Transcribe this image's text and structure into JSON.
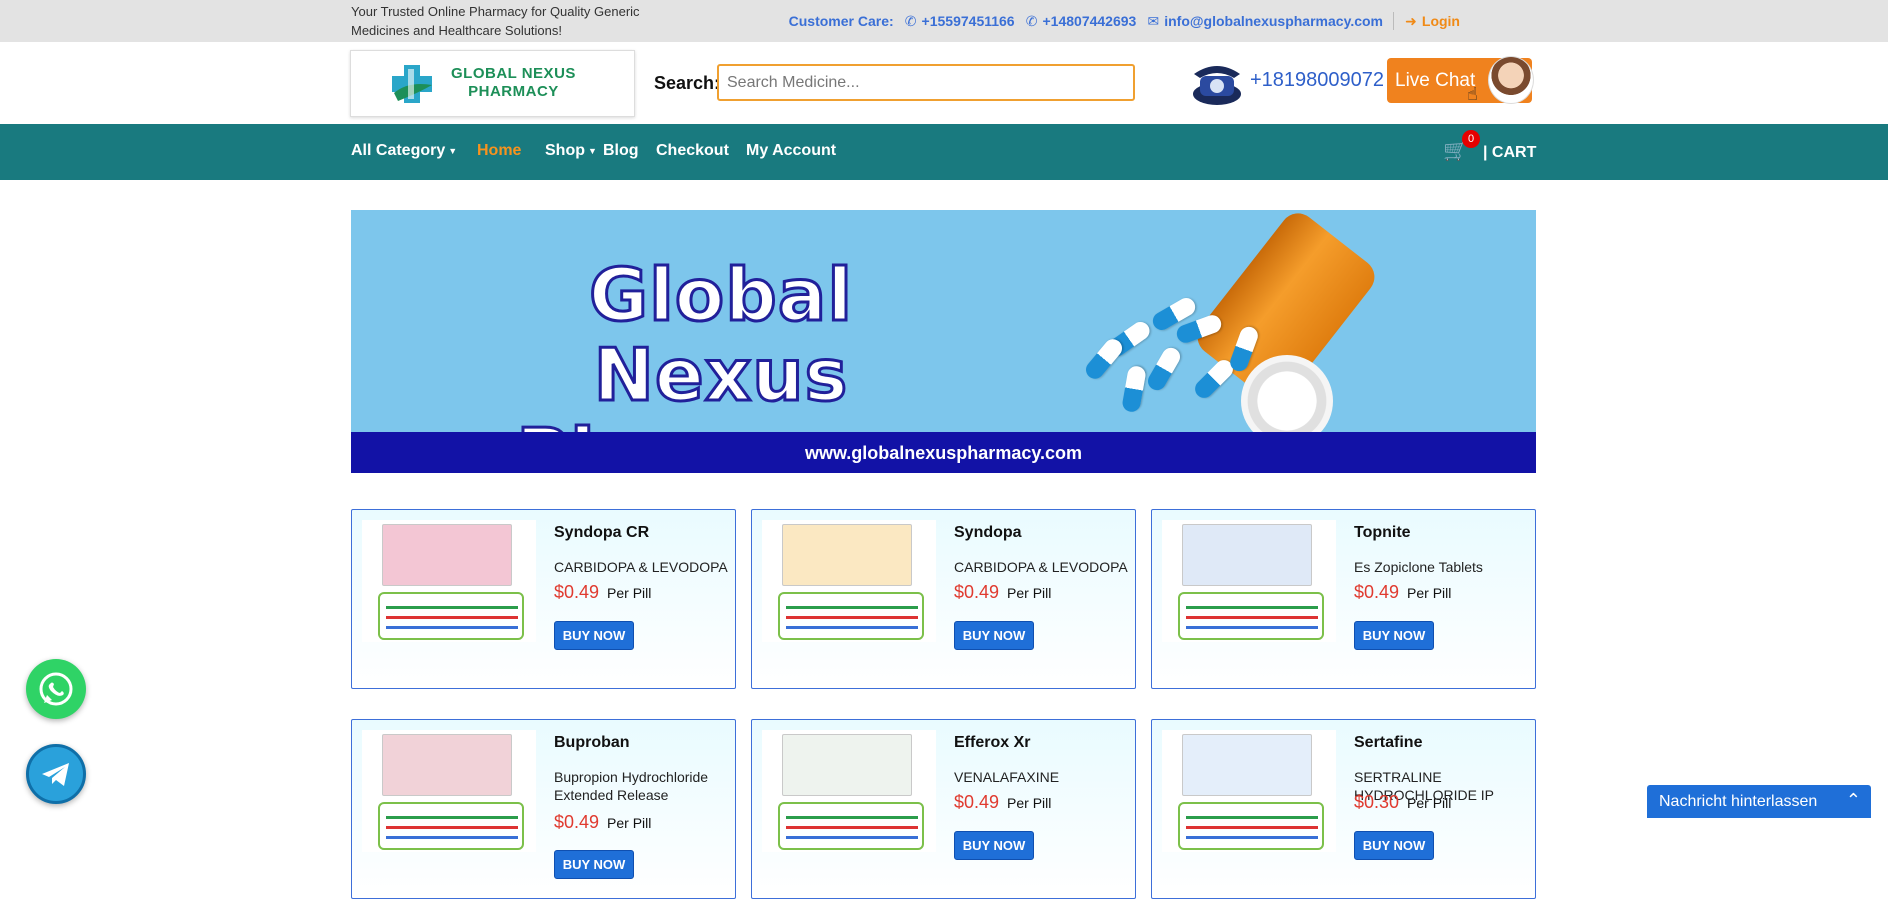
{
  "topbar": {
    "tagline": "Your Trusted Online Pharmacy for Quality Generic Medicines and Healthcare Solutions!",
    "customer_care_label": "Customer Care:",
    "phone_1": "+15597451166",
    "phone_2": "+14807442693",
    "email": "info@globalnexuspharmacy.com",
    "login_label": "Login"
  },
  "header": {
    "logo_line_1": "GLOBAL NEXUS",
    "logo_line_2": "PHARMACY",
    "search_label": "Search:",
    "search_placeholder": "Search Medicine...",
    "phone": "+18198009072",
    "live_chat_label": "Live Chat"
  },
  "nav": {
    "items": [
      {
        "label": "All Category",
        "has_caret": true
      },
      {
        "label": "Home",
        "active": true
      },
      {
        "label": "Shop",
        "has_caret": true
      },
      {
        "label": "Blog"
      },
      {
        "label": "Checkout"
      },
      {
        "label": "My Account"
      }
    ],
    "cart_count": "0",
    "cart_label": "| CART"
  },
  "banner": {
    "title": "Global Nexus Pharmacy",
    "url": "www.globalnexuspharmacy.com"
  },
  "products": [
    {
      "name": "Syndopa CR",
      "generic": "CARBIDOPA & LEVODOPA",
      "price": "$0.49",
      "unit": "Per Pill",
      "buy_label": "BUY NOW",
      "box_color": "#f3c6d4"
    },
    {
      "name": "Syndopa",
      "generic": "CARBIDOPA & LEVODOPA",
      "price": "$0.49",
      "unit": "Per Pill",
      "buy_label": "BUY NOW",
      "box_color": "#fbe8c2"
    },
    {
      "name": "Topnite",
      "generic": "Es Zopiclone Tablets",
      "price": "$0.49",
      "unit": "Per Pill",
      "buy_label": "BUY NOW",
      "box_color": "#dfe9f7"
    },
    {
      "name": "Buproban",
      "generic": "Bupropion Hydrochloride Extended Release",
      "price": "$0.49",
      "unit": "Per Pill",
      "buy_label": "BUY NOW",
      "box_color": "#f1d2d8"
    },
    {
      "name": "Efferox Xr",
      "generic": "VENALAFAXINE",
      "price": "$0.49",
      "unit": "Per Pill",
      "buy_label": "BUY NOW",
      "box_color": "#eef3ee"
    },
    {
      "name": "Sertafine",
      "generic": "SERTRALINE HYDROCHLORIDE IP",
      "price": "$0.30",
      "unit": "Per Pill",
      "buy_label": "BUY NOW",
      "box_color": "#e4eefa"
    }
  ],
  "widgets": {
    "leave_message_label": "Nachricht hinterlassen"
  },
  "icons": [
    "phone-icon",
    "envelope-icon",
    "login-icon",
    "cart-icon",
    "whatsapp-icon",
    "telegram-icon",
    "chevron-up-icon"
  ],
  "colors": {
    "nav_bg": "#197a7f",
    "accent_orange": "#f7931e",
    "link_blue": "#3a6fd6",
    "price_red": "#e03a2f",
    "banner_bg": "#7dc6ec",
    "button_blue": "#1f6fd8"
  }
}
